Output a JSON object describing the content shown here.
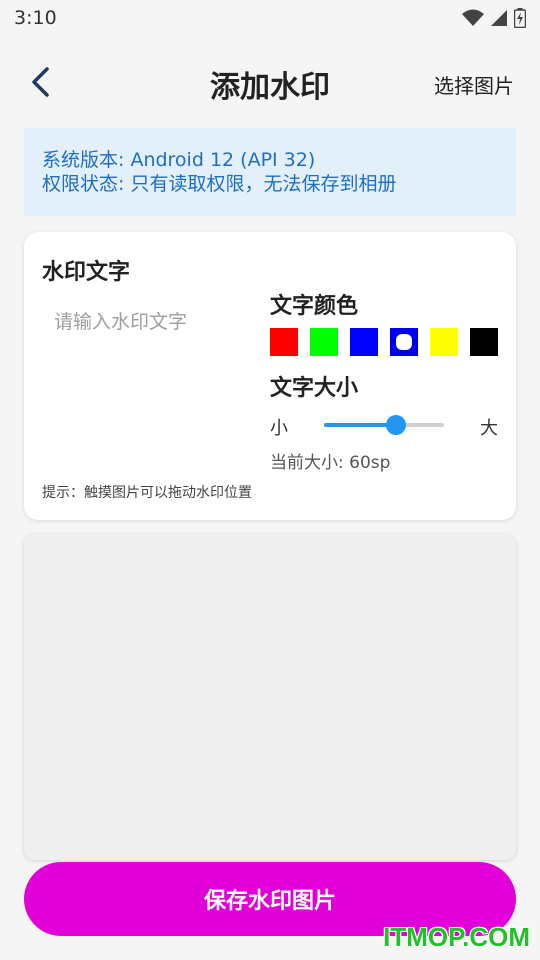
{
  "status_bar": {
    "time": "3:10",
    "icons": [
      "wifi-icon",
      "signal-icon",
      "battery-charging-icon"
    ]
  },
  "app_bar": {
    "back_icon": "chevron-left-icon",
    "title": "添加水印",
    "select_image_label": "选择图片"
  },
  "info": {
    "system_version": "系统版本: Android 12 (API 32)",
    "permission_status": "权限状态: 只有读取权限，无法保存到相册"
  },
  "settings": {
    "watermark_text_title": "水印文字",
    "watermark_text_value": "",
    "watermark_text_placeholder": "请输入水印文字",
    "color_title": "文字颜色",
    "colors": [
      {
        "name": "red",
        "hex": "#ff0000",
        "selected": false
      },
      {
        "name": "green",
        "hex": "#00ff00",
        "selected": false
      },
      {
        "name": "blue",
        "hex": "#0000ff",
        "selected": false
      },
      {
        "name": "blue-dark",
        "hex": "#0000ee",
        "selected": true
      },
      {
        "name": "yellow",
        "hex": "#ffff00",
        "selected": false
      },
      {
        "name": "black",
        "hex": "#000000",
        "selected": false
      }
    ],
    "size_title": "文字大小",
    "size_min_label": "小",
    "size_max_label": "大",
    "size_level": 0.6,
    "current_size": "当前大小: 60sp",
    "hint": "提示：触摸图片可以拖动水印位置"
  },
  "actions": {
    "save_label": "保存水印图片"
  },
  "colors": {
    "accent": "#2196f3",
    "save_button": "#e100d8",
    "banner_bg": "#e3f0fb",
    "banner_text": "#1e6fc2"
  },
  "site_watermark": "ITMOP.COM"
}
